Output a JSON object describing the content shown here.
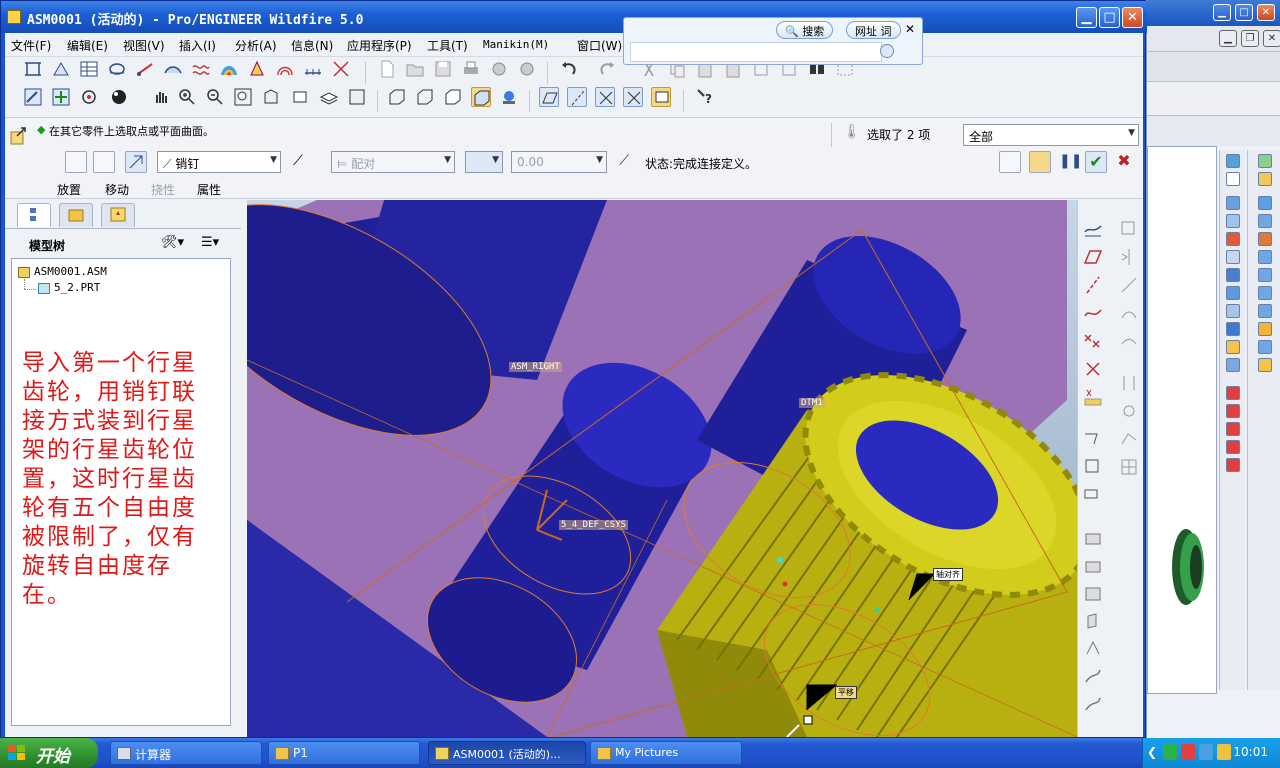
{
  "window": {
    "title": "ASM0001 (活动的) - Pro/ENGINEER Wildfire 5.0",
    "controls": {
      "minimize": "▁",
      "maximize": "□",
      "close": "✕"
    }
  },
  "menubar": {
    "items": [
      "文件(F)",
      "编辑(E)",
      "视图(V)",
      "插入(I)",
      "分析(A)",
      "信息(N)",
      "应用程序(P)",
      "工具(T)",
      "Manikin(M)",
      "窗口(W)"
    ]
  },
  "iebar": {
    "search_label": "搜索",
    "url_label": "网址 词"
  },
  "dashboard": {
    "prompt": "在其它零件上选取点或平面曲面。",
    "selected": "选取了 2 项",
    "filter": "全部",
    "connection_type": "销钉",
    "constraint_type": "配对",
    "offset_value": "0.00",
    "status": "状态:完成连接定义。",
    "tabs": [
      "放置",
      "移动",
      "挠性",
      "属性"
    ]
  },
  "model_tree": {
    "title": "模型树",
    "items": [
      "ASM0001.ASM",
      "5_2.PRT"
    ],
    "annotation": "导入第一个行星齿轮，用销钉联接方式装到行星架的行星齿轮位置，这时行星齿轮有五个自由度被限制了，仅有旋转自由度存在。"
  },
  "viewport": {
    "labels": {
      "plane": "ASM_RIGHT",
      "csys": "5_4_DEF_CSYS",
      "axis": "DTM1",
      "tag1": "轴对齐",
      "tag2": "平移"
    }
  },
  "taskbar": {
    "start": "开始",
    "tasks": [
      "计算器",
      "P1",
      "ASM0001 (活动的)...",
      "My Pictures"
    ],
    "clock": "10:01"
  },
  "colors": {
    "titlebar": "#1c5fd4",
    "gear": "#c8c21a",
    "carrier": "#2a2aa8",
    "plate": "#9c72b6",
    "annotation": "#e01818"
  }
}
